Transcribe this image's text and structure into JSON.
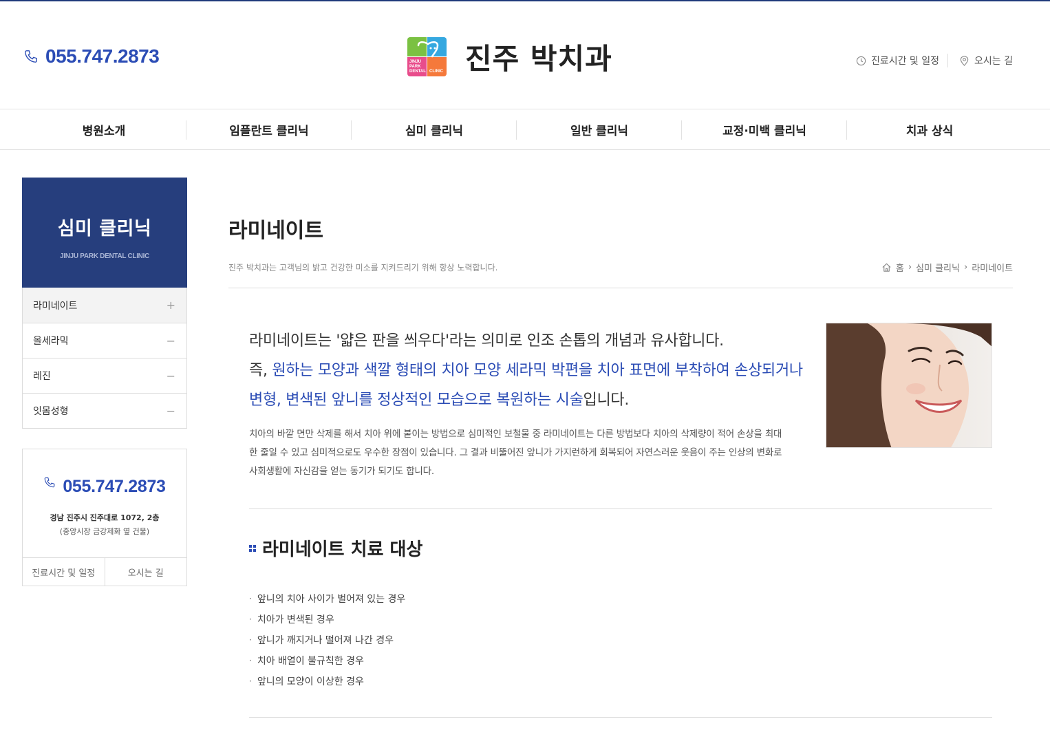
{
  "header": {
    "phone": "055.747.2873",
    "logo_name": "진주 박치과",
    "logo_mark_text": [
      "JINJU",
      "PARK",
      "DENTAL",
      "CLINIC"
    ],
    "links": [
      {
        "label": "진료시간 및 일정",
        "icon": "clock-icon"
      },
      {
        "label": "오시는 길",
        "icon": "map-pin-icon"
      }
    ]
  },
  "nav": {
    "items": [
      "병원소개",
      "임플란트 클리닉",
      "심미 클리닉",
      "일반 클리닉",
      "교정·미백 클리닉",
      "치과 상식"
    ]
  },
  "sidebar": {
    "title": "심미 클리닉",
    "subtitle": "JINJU PARK DENTAL CLINIC",
    "menu": [
      {
        "label": "라미네이트",
        "sign": "+"
      },
      {
        "label": "올세라믹",
        "sign": "−"
      },
      {
        "label": "레진",
        "sign": "−"
      },
      {
        "label": "잇몸성형",
        "sign": "−"
      }
    ],
    "contact": {
      "phone": "055.747.2873",
      "address": "경남 진주시 진주대로 1072, 2층",
      "address_note": "(중앙시장 금강제화 옆 건물)",
      "btn_hours": "진료시간 및 일정",
      "btn_directions": "오시는 길"
    }
  },
  "main": {
    "title": "라미네이트",
    "description": "진주 박치과는 고객님의 밝고 건강한 미소를 지켜드리기 위해 항상 노력합니다.",
    "breadcrumb": [
      "홈",
      "심미 클리닉",
      "라미네이트"
    ],
    "lead_line1": "라미네이트는 '얇은 판을 씌우다'라는 의미로 인조 손톱의 개념과 유사합니다.",
    "lead_prefix": "즉, ",
    "lead_highlight": "원하는 모양과 색깔 형태의 치아 모양 세라믹 박편을 치아 표면에 부착하여 손상되거나 변형, 변색된 앞니를 정상적인 모습으로 복원하는 시술",
    "lead_suffix": "입니다.",
    "body": "치아의 바깥 면만 삭제를 해서 치아 위에 붙이는 방법으로 심미적인 보철물 중 라미네이트는 다른 방법보다 치아의 삭제량이 적어 손상을 최대한 줄일 수 있고 심미적으로도 우수한 장점이 있습니다. 그 결과 비뚤어진 앞니가 가지런하게 회복되어 자연스러운 웃음이 주는 인상의 변화로 사회생활에 자신감을 얻는 동기가 되기도 합니다.",
    "section_title": "라미네이트 치료 대상",
    "list": [
      "앞니의 치아 사이가 벌어져 있는 경우",
      "치아가 변색된 경우",
      "앞니가 깨지거나 떨어져 나간 경우",
      "치아 배열이 불규칙한 경우",
      "앞니의 모양이 이상한 경우"
    ]
  },
  "colors": {
    "accent": "#2b4cb5",
    "sidebar_head": "#263e7d"
  }
}
